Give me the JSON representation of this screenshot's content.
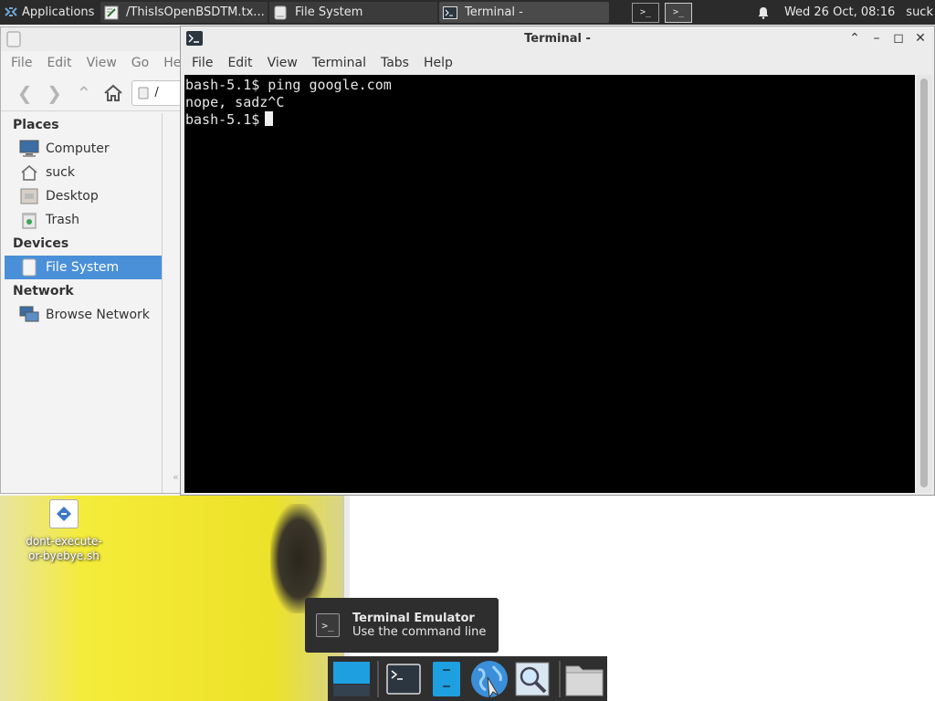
{
  "top_panel": {
    "apps_label": "Applications",
    "tasks": [
      {
        "label": "/ThisIsOpenBSDTM.tx..."
      },
      {
        "label": "File System"
      },
      {
        "label": "Terminal -"
      }
    ],
    "clock": "Wed 26 Oct, 08:16",
    "user": "suck"
  },
  "file_manager": {
    "menu": [
      "File",
      "Edit",
      "View",
      "Go",
      "Hel"
    ],
    "path": "/",
    "sections": {
      "places": "Places",
      "devices": "Devices",
      "network": "Network"
    },
    "places": [
      {
        "label": "Computer",
        "icon": "computer-icon"
      },
      {
        "label": "suck",
        "icon": "home-folder-icon"
      },
      {
        "label": "Desktop",
        "icon": "desktop-icon"
      },
      {
        "label": "Trash",
        "icon": "trash-icon"
      }
    ],
    "devices": [
      {
        "label": "File System",
        "icon": "drive-icon",
        "selected": true
      }
    ],
    "network": [
      {
        "label": "Browse Network",
        "icon": "network-icon"
      }
    ]
  },
  "terminal": {
    "title": "Terminal -",
    "menu": [
      "File",
      "Edit",
      "View",
      "Terminal",
      "Tabs",
      "Help"
    ],
    "lines": [
      "bash-5.1$ ping google.com",
      "nope, sadz^C",
      "bash-5.1$"
    ]
  },
  "desktop": {
    "icon_label": "dont-execute-or-byebye.sh"
  },
  "tooltip": {
    "title": "Terminal Emulator",
    "subtitle": "Use the command line"
  },
  "dock": {
    "items": [
      "show-desktop-icon",
      "terminal-icon",
      "file-manager-icon",
      "web-browser-icon",
      "app-finder-icon",
      "folder-icon"
    ]
  },
  "colors": {
    "selection": "#4a90d9",
    "terminal_bg": "#000000",
    "panel_bg": "#2b2b2b"
  }
}
